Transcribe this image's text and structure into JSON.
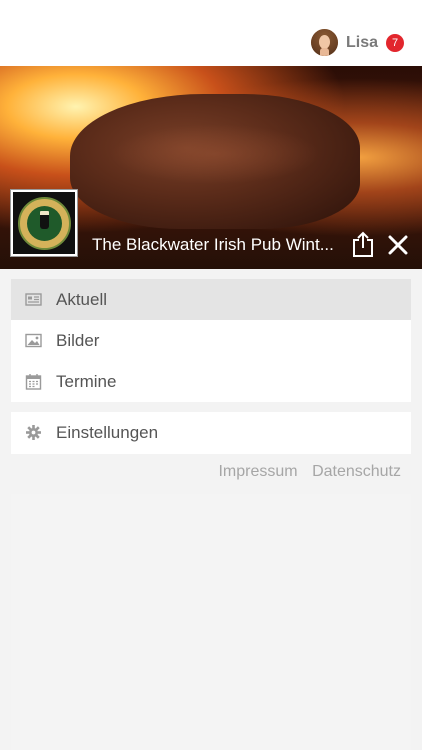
{
  "header": {
    "user_name": "Lisa",
    "notification_count": "7",
    "colors": {
      "badge": "#e2262d",
      "user_name": "#7a7a7a"
    },
    "icons": {
      "avatar": "user-avatar-photo"
    }
  },
  "hero": {
    "title": "The Blackwater Irish Pub Wint...",
    "image": "grilled-steak-over-flames",
    "icons": {
      "logo": "blackwater-irish-pub-logo",
      "share": "share-icon",
      "close": "close-icon"
    }
  },
  "menu": {
    "items": [
      {
        "label": "Aktuell",
        "icon": "news-icon",
        "active": true
      },
      {
        "label": "Bilder",
        "icon": "image-icon",
        "active": false
      },
      {
        "label": "Termine",
        "icon": "calendar-icon",
        "active": false
      }
    ],
    "settings": {
      "label": "Einstellungen",
      "icon": "gear-icon"
    }
  },
  "footer": {
    "impressum": "Impressum",
    "datenschutz": "Datenschutz"
  }
}
